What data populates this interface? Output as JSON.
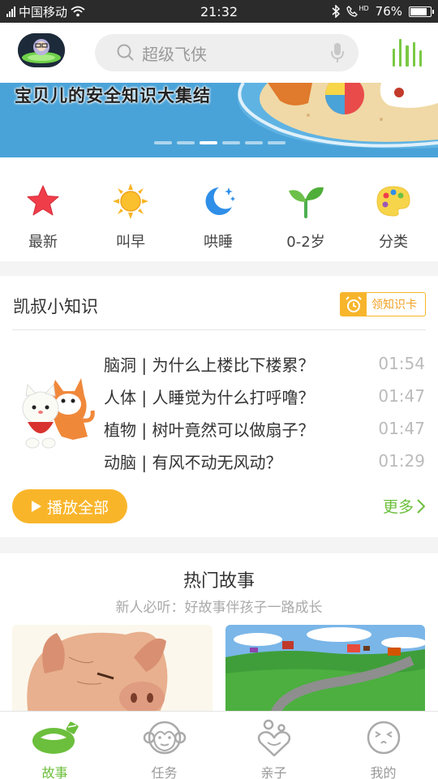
{
  "status_bar": {
    "carrier": "中国移动",
    "time": "21:32",
    "network": "HD",
    "battery": "76%",
    "battery_level": 0.76
  },
  "header": {
    "search_placeholder": "超级飞侠"
  },
  "banner": {
    "title": "宝贝儿的安全知识大集结",
    "page_count": 6,
    "active_page": 3
  },
  "categories": [
    {
      "label": "最新",
      "icon": "star-icon"
    },
    {
      "label": "叫早",
      "icon": "sun-icon"
    },
    {
      "label": "哄睡",
      "icon": "moon-icon"
    },
    {
      "label": "0-2岁",
      "icon": "sprout-icon"
    },
    {
      "label": "分类",
      "icon": "palette-icon"
    }
  ],
  "knowledge": {
    "title": "凯叔小知识",
    "badge": "领知识卡",
    "tracks": [
      {
        "title": "脑洞 | 为什么上楼比下楼累？",
        "duration": "01:54"
      },
      {
        "title": "人体 | 人睡觉为什么打呼噜？",
        "duration": "01:47"
      },
      {
        "title": "植物 | 树叶竟然可以做扇子？",
        "duration": "01:47"
      },
      {
        "title": "动脑 | 有风不动无风动？",
        "duration": "01:29"
      }
    ],
    "play_all": "播放全部",
    "more": "更多"
  },
  "hot_stories": {
    "title": "热门故事",
    "subtitle": "新人必听：好故事伴孩子一路成长"
  },
  "tabs": [
    {
      "label": "故事",
      "icon": "story-icon",
      "active": true
    },
    {
      "label": "任务",
      "icon": "monkey-icon",
      "active": false
    },
    {
      "label": "亲子",
      "icon": "parent-child-icon",
      "active": false
    },
    {
      "label": "我的",
      "icon": "profile-face-icon",
      "active": false
    }
  ],
  "colors": {
    "accent_green": "#6cbf3c",
    "accent_orange": "#f9b52a",
    "status_bar": "#2b2b2b"
  }
}
